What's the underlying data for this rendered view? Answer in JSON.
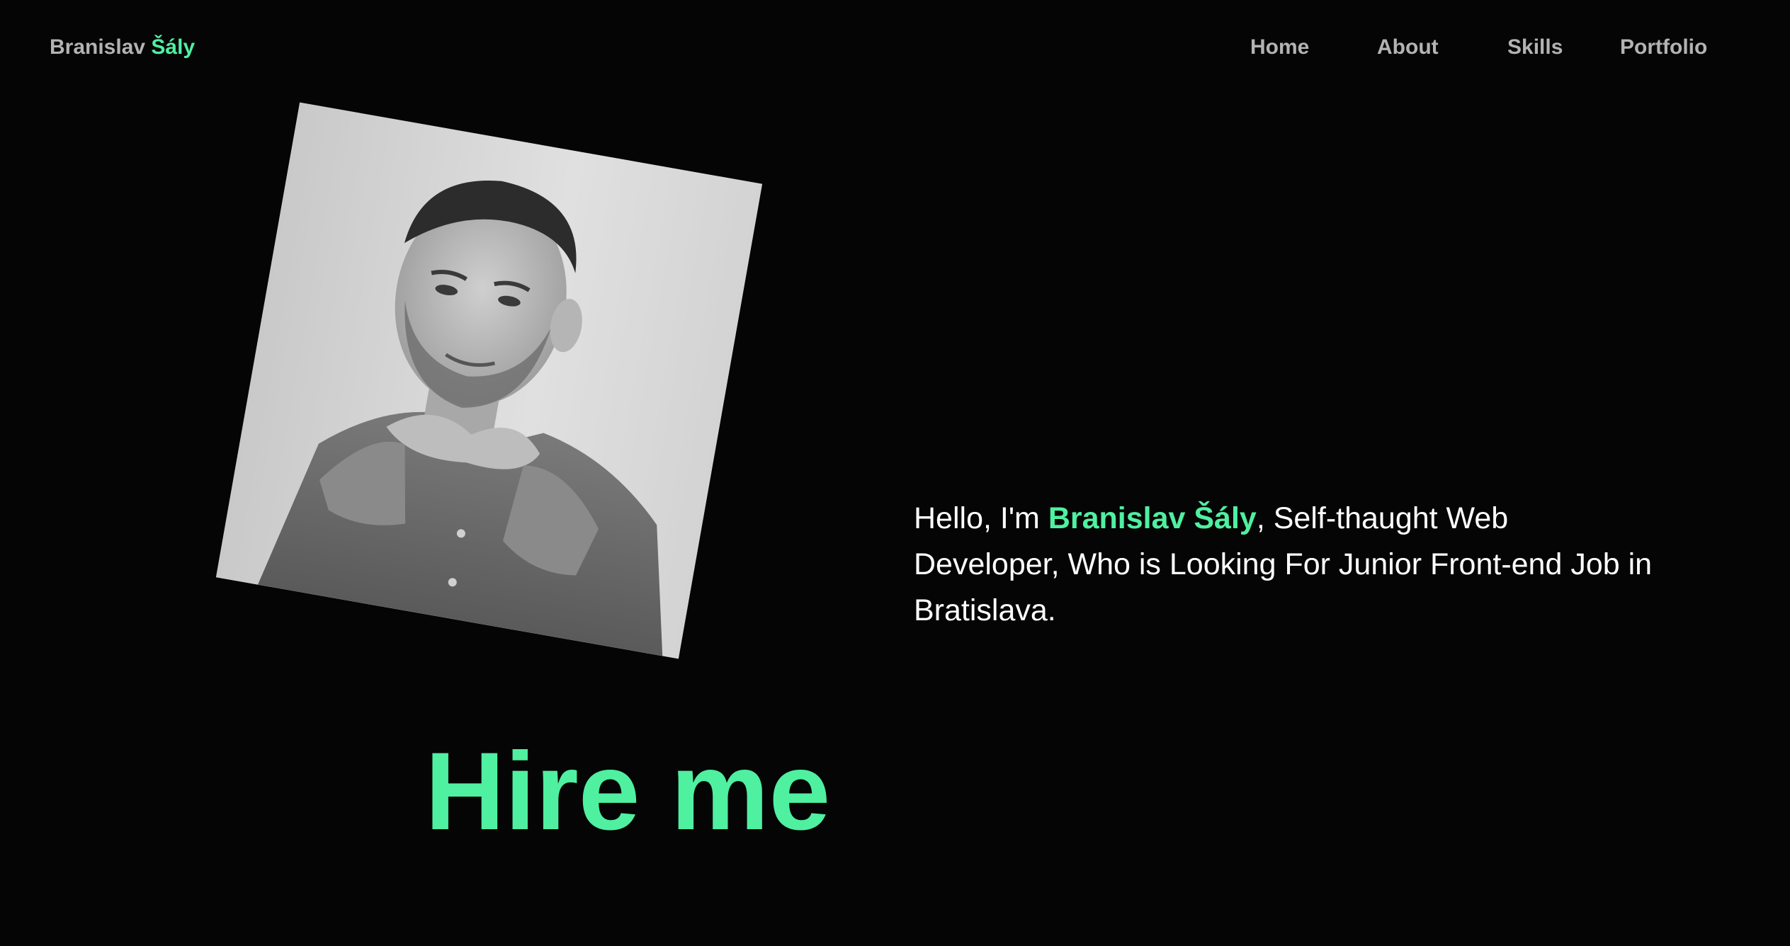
{
  "brand": {
    "first_name": "Branislav",
    "last_name": "Šály",
    "accent_color": "#4ff0a0"
  },
  "nav": {
    "items": [
      {
        "label": "Home"
      },
      {
        "label": "About"
      },
      {
        "label": "Skills"
      },
      {
        "label": "Portfolio"
      }
    ]
  },
  "hero": {
    "greeting": "Hello, I'm ",
    "name": "Branislav Šály",
    "description": ", Self-thaught Web Developer, Who is Looking For Junior Front-end Job in Bratislava.",
    "cta_label": "Hire me",
    "photo_icon": "portrait-photo"
  },
  "colors": {
    "background": "#050506",
    "nav_text": "#b3b3b3",
    "body_text": "#ffffff",
    "accent": "#4ff0a0"
  }
}
